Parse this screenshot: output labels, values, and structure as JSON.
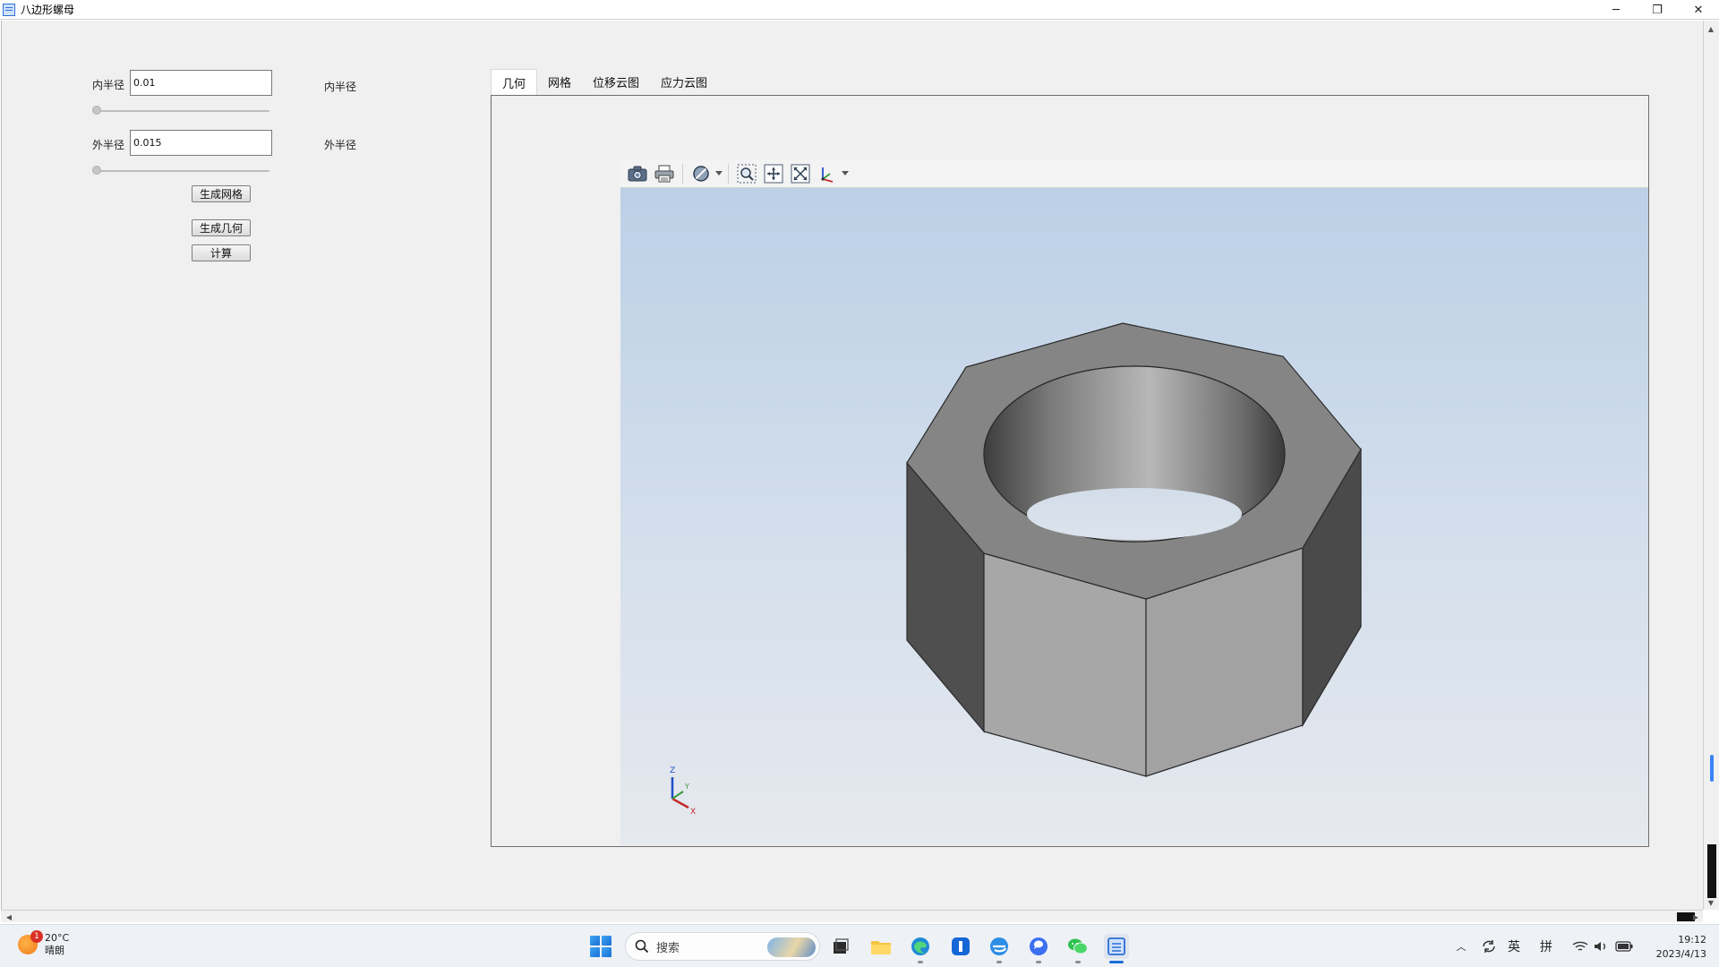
{
  "window": {
    "title": "八边形螺母",
    "minimize": "─",
    "restore": "❐",
    "close": "✕"
  },
  "left_panel": {
    "inner_radius_label": "内半径",
    "inner_radius_value": "0.01",
    "inner_radius_label_right": "内半径",
    "inner_radius_slider": 0,
    "outer_radius_label": "外半径",
    "outer_radius_value": "0.015",
    "outer_radius_label_right": "外半径",
    "outer_radius_slider": 0,
    "btn_generate_mesh": "生成网格",
    "btn_generate_geometry": "生成几何",
    "btn_compute": "计算"
  },
  "tabs": [
    "几何",
    "网格",
    "位移云图",
    "应力云图"
  ],
  "active_tab": 0,
  "viewer": {
    "toolbar_icons": [
      "camera-icon",
      "print-icon",
      "hide-shape-icon",
      "zoom-window-icon",
      "fit-all-icon",
      "zoom-extents-icon",
      "axis-view-icon"
    ],
    "axes": {
      "z": "Z",
      "y": "Y",
      "x": "X"
    },
    "colors": {
      "bg_top": "#bcd0e6",
      "bg_bottom": "#e6e9ee",
      "top_face": "#858585",
      "side_light": "#a6a6a6",
      "side_dark": "#4e4e4e"
    }
  },
  "taskbar": {
    "weather_temp": "20°C",
    "weather_desc": "晴朗",
    "weather_badge": "1",
    "search_placeholder": "搜索",
    "ime_lang": "英",
    "ime_mode": "拼",
    "time": "19:12",
    "date": "2023/4/13"
  }
}
